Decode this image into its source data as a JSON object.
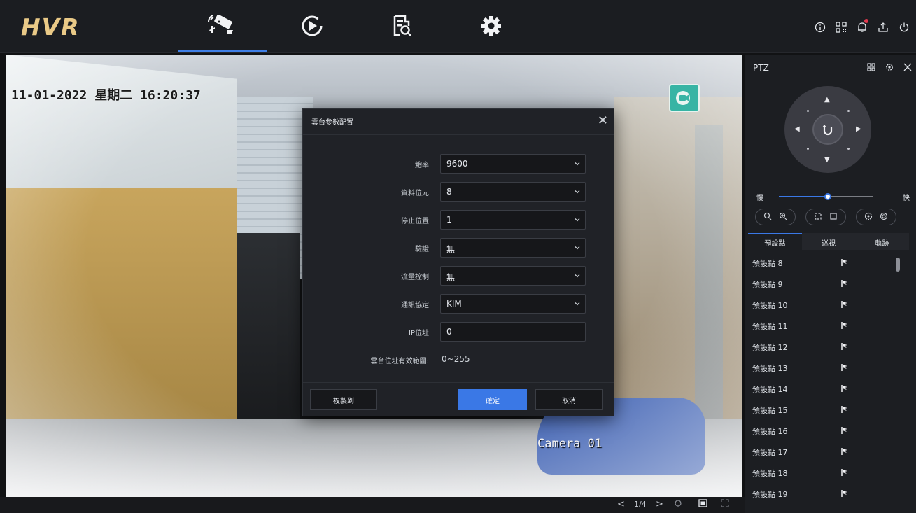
{
  "app": {
    "logo": "HVR"
  },
  "nav": {
    "tabs": [
      {
        "name": "live-view",
        "icon": "camera-icon",
        "active": true
      },
      {
        "name": "playback",
        "icon": "playback-icon",
        "active": false
      },
      {
        "name": "search",
        "icon": "file-search-icon",
        "active": false
      },
      {
        "name": "settings",
        "icon": "gear-icon",
        "active": false
      }
    ],
    "right_icons": [
      "info-icon",
      "qr-icon",
      "bell-icon",
      "export-icon",
      "power-icon"
    ]
  },
  "video": {
    "timestamp": "11-01-2022 星期二 16:20:37",
    "camera_label": "Camera 01",
    "page": "1/4"
  },
  "dialog": {
    "title": "雲台參數配置",
    "fields": [
      {
        "label": "鮑率",
        "value": "9600",
        "type": "select"
      },
      {
        "label": "資料位元",
        "value": "8",
        "type": "select"
      },
      {
        "label": "停止位置",
        "value": "1",
        "type": "select"
      },
      {
        "label": "驗證",
        "value": "無",
        "type": "select"
      },
      {
        "label": "流量控制",
        "value": "無",
        "type": "select"
      },
      {
        "label": "通訊協定",
        "value": "KIM",
        "type": "select"
      },
      {
        "label": "IP位址",
        "value": "0",
        "type": "input"
      }
    ],
    "range_label": "雲台位址有效範圍:",
    "range_value": "0~255",
    "copy_button": "複製到",
    "ok_button": "確定",
    "cancel_button": "取消"
  },
  "ptz": {
    "title": "PTZ",
    "speed_slow": "慢",
    "speed_fast": "快",
    "speed_level": 0.52,
    "tabs": [
      "預設點",
      "巡視",
      "軌跡"
    ],
    "presets": [
      "預設點 8",
      "預設點 9",
      "預設點 10",
      "預設點 11",
      "預設點 12",
      "預設點 13",
      "預設點 14",
      "預設點 15",
      "預設點 16",
      "預設點 17",
      "預設點 18",
      "預設點 19"
    ]
  },
  "colors": {
    "accent": "#3a78e6",
    "logo": "#e9c987",
    "alert": "#e2384d"
  }
}
